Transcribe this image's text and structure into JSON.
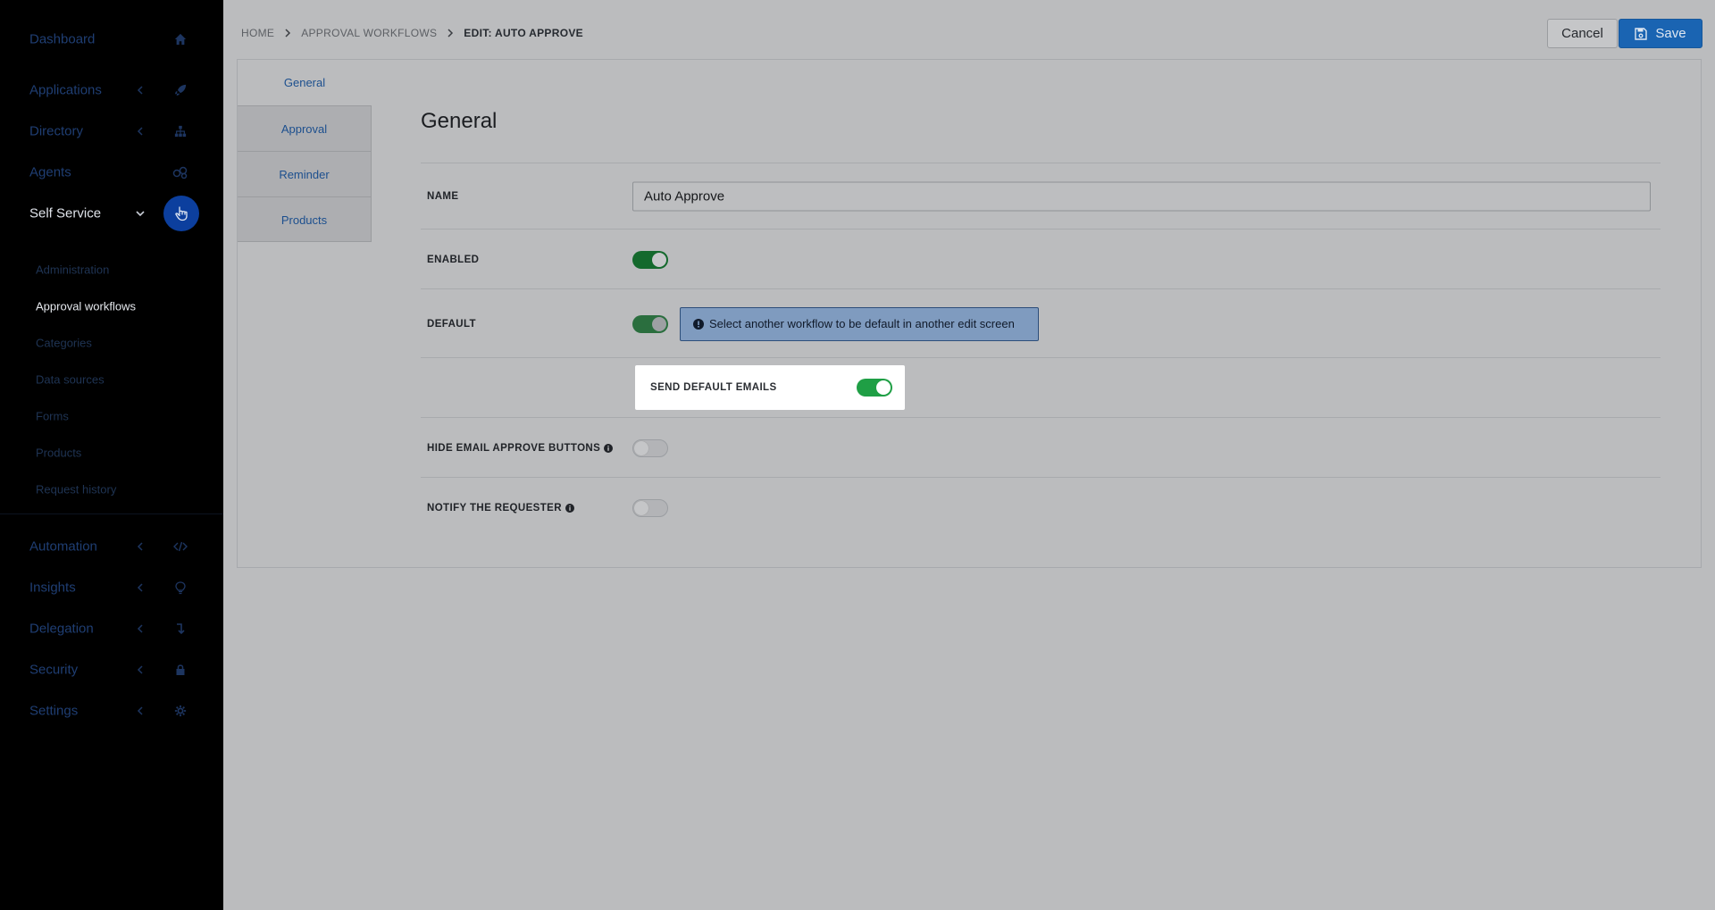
{
  "sidebar": {
    "items": [
      {
        "label": "Dashboard",
        "icon": "home-icon"
      },
      {
        "label": "Applications",
        "icon": "rocket-icon"
      },
      {
        "label": "Directory",
        "icon": "sitemap-icon"
      },
      {
        "label": "Agents",
        "icon": "agents-icon"
      },
      {
        "label": "Self Service",
        "icon": "hand-pointer-icon"
      },
      {
        "label": "Automation",
        "icon": "code-icon"
      },
      {
        "label": "Insights",
        "icon": "lightbulb-icon"
      },
      {
        "label": "Delegation",
        "icon": "level-down-icon"
      },
      {
        "label": "Security",
        "icon": "lock-icon"
      },
      {
        "label": "Settings",
        "icon": "gear-icon"
      }
    ],
    "self_service_sub": [
      "Administration",
      "Approval workflows",
      "Categories",
      "Data sources",
      "Forms",
      "Products",
      "Request history"
    ]
  },
  "breadcrumb": {
    "home": "HOME",
    "section": "APPROVAL WORKFLOWS",
    "current": "EDIT: AUTO APPROVE"
  },
  "toolbar": {
    "cancel_label": "Cancel",
    "save_label": "Save"
  },
  "tabs": [
    "General",
    "Approval",
    "Reminder",
    "Products"
  ],
  "form": {
    "title": "General",
    "name_label": "NAME",
    "name_value": "Auto Approve",
    "enabled_label": "ENABLED",
    "default_label": "DEFAULT",
    "default_info": "Select another workflow to be default in another edit screen",
    "send_default_emails_label": "SEND DEFAULT EMAILS",
    "hide_email_buttons_label": "HIDE EMAIL APPROVE BUTTONS",
    "notify_requester_label": "NOTIFY THE REQUESTER"
  },
  "colors": {
    "sidebar_bg": "#000000",
    "accent_blue": "#1a64b2",
    "toggle_on": "#1f9f45"
  }
}
